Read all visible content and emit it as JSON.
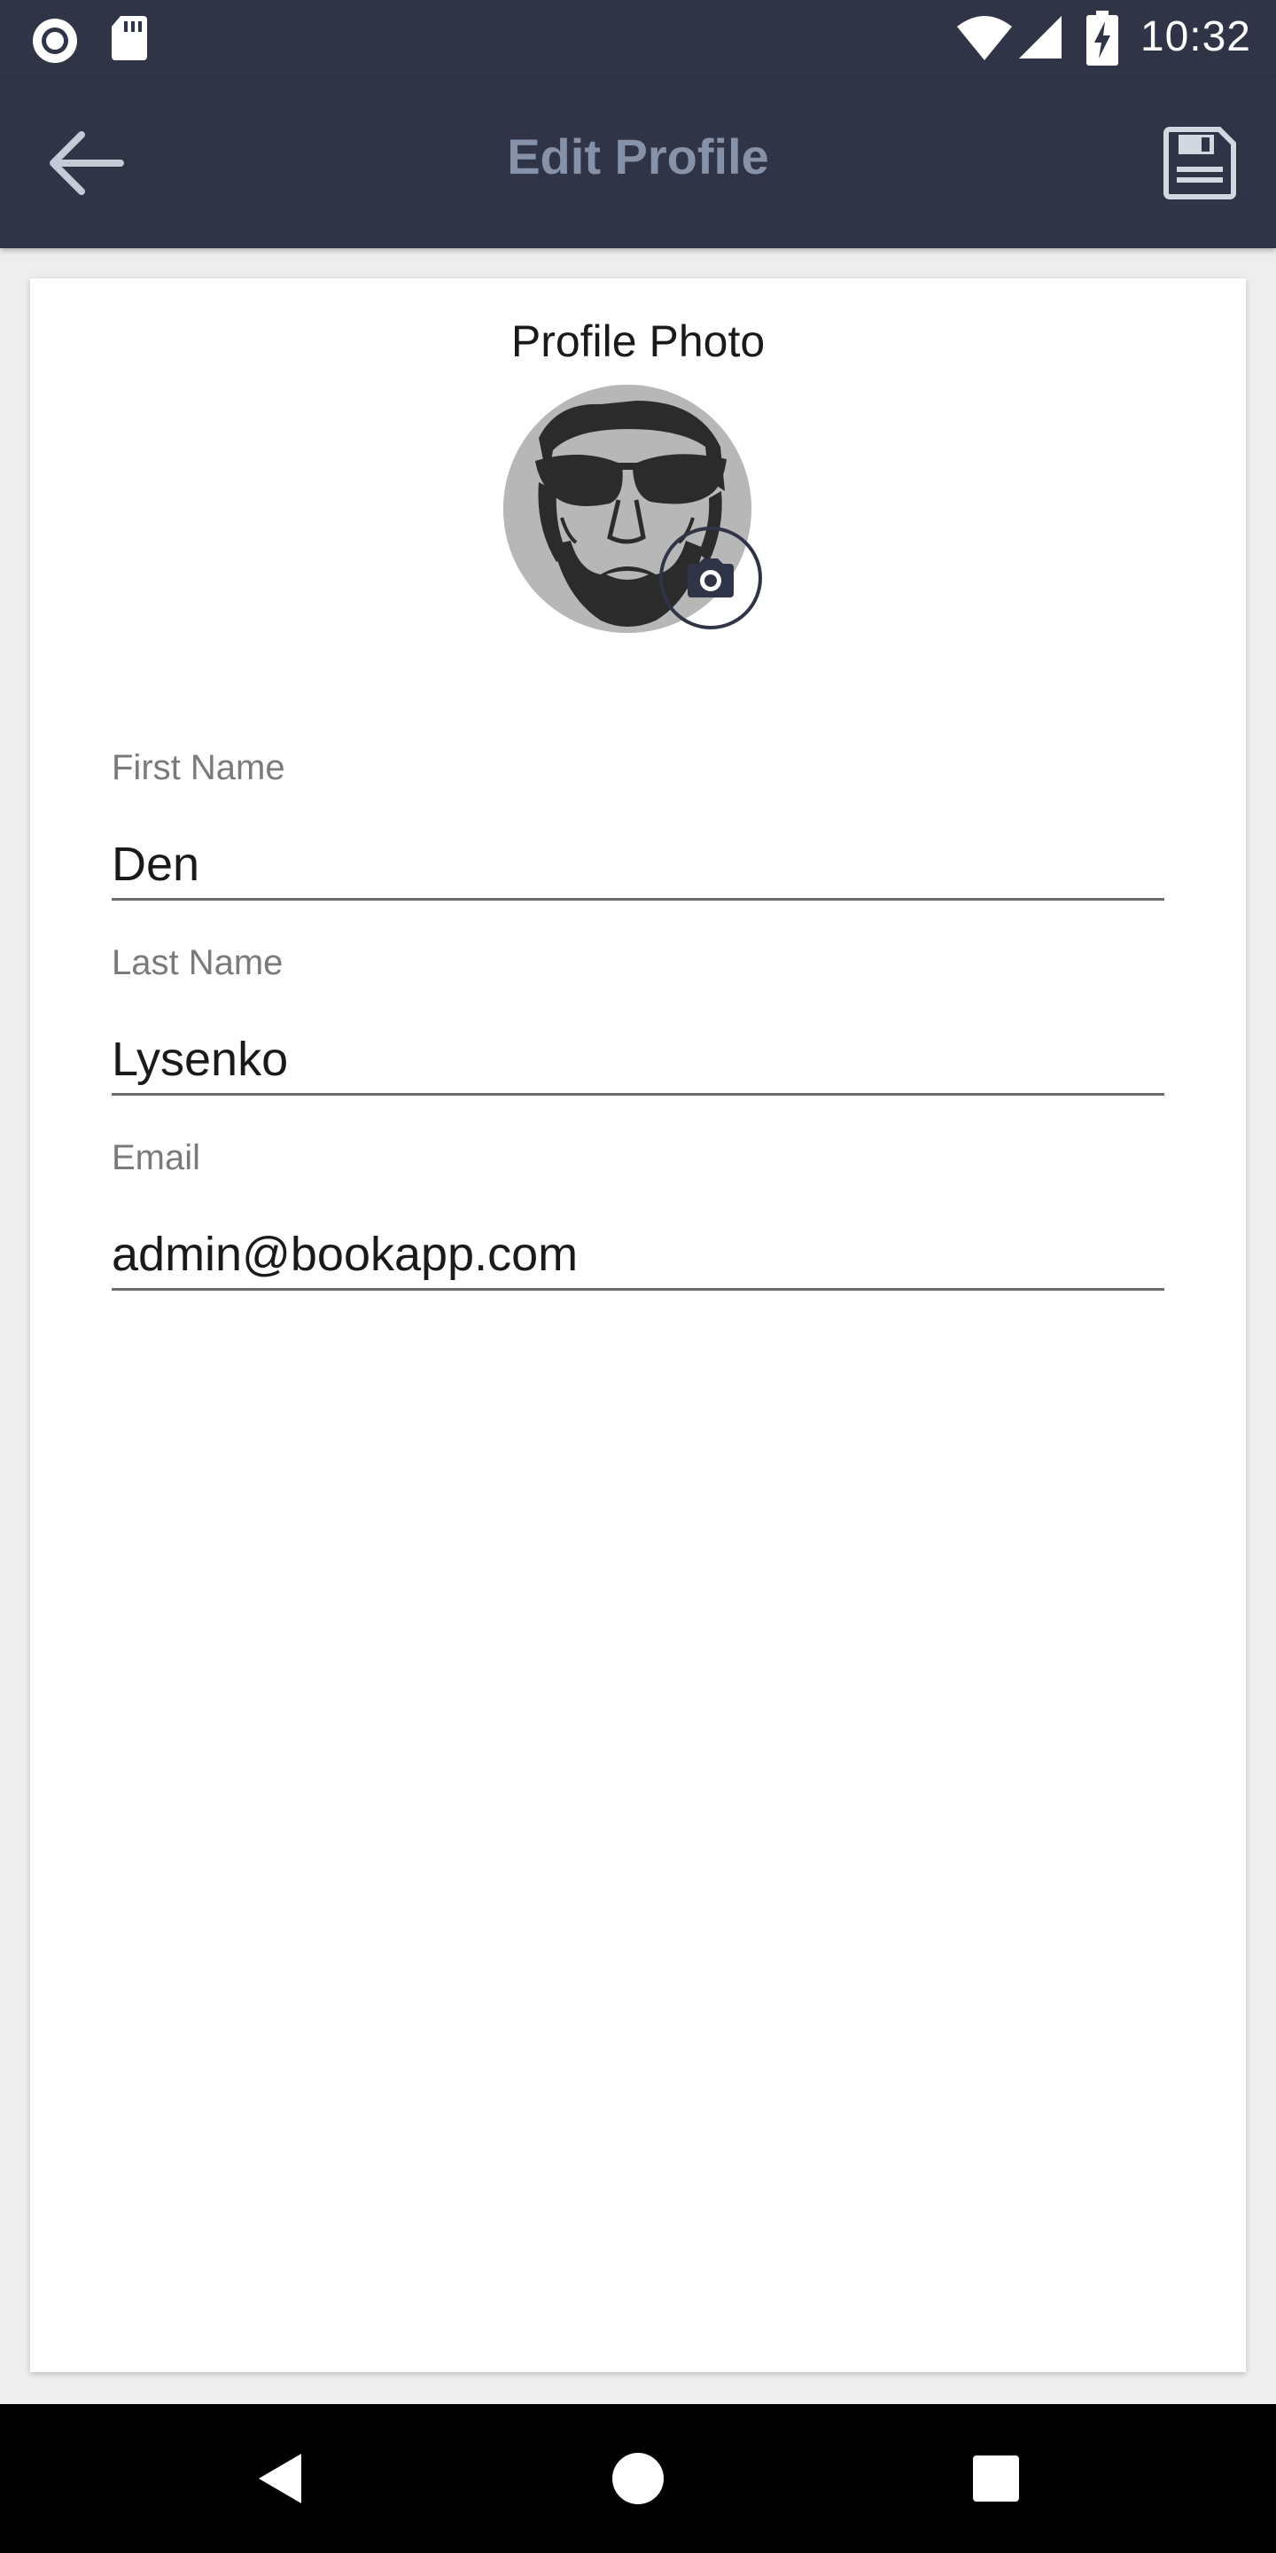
{
  "status_bar": {
    "time": "10:32",
    "icons": [
      "record-icon",
      "sd-card-icon",
      "wifi-icon",
      "signal-icon",
      "battery-charging-icon"
    ]
  },
  "app_bar": {
    "title": "Edit Profile",
    "back_icon": "arrow-left-icon",
    "save_icon": "floppy-disk-icon"
  },
  "profile": {
    "photo_title": "Profile Photo",
    "camera_icon": "camera-icon"
  },
  "form": {
    "first_name": {
      "label": "First Name",
      "value": "Den"
    },
    "last_name": {
      "label": "Last Name",
      "value": "Lysenko"
    },
    "email": {
      "label": "Email",
      "value": "admin@bookapp.com"
    }
  },
  "nav_bar": {
    "icons": [
      "back-triangle-icon",
      "home-circle-icon",
      "recents-square-icon"
    ]
  },
  "colors": {
    "app_bar": "#2f3447",
    "title_text": "#8791a7",
    "background": "#eeeeee",
    "card": "#ffffff",
    "label": "#7a7a7a",
    "nav_bar": "#000000"
  }
}
